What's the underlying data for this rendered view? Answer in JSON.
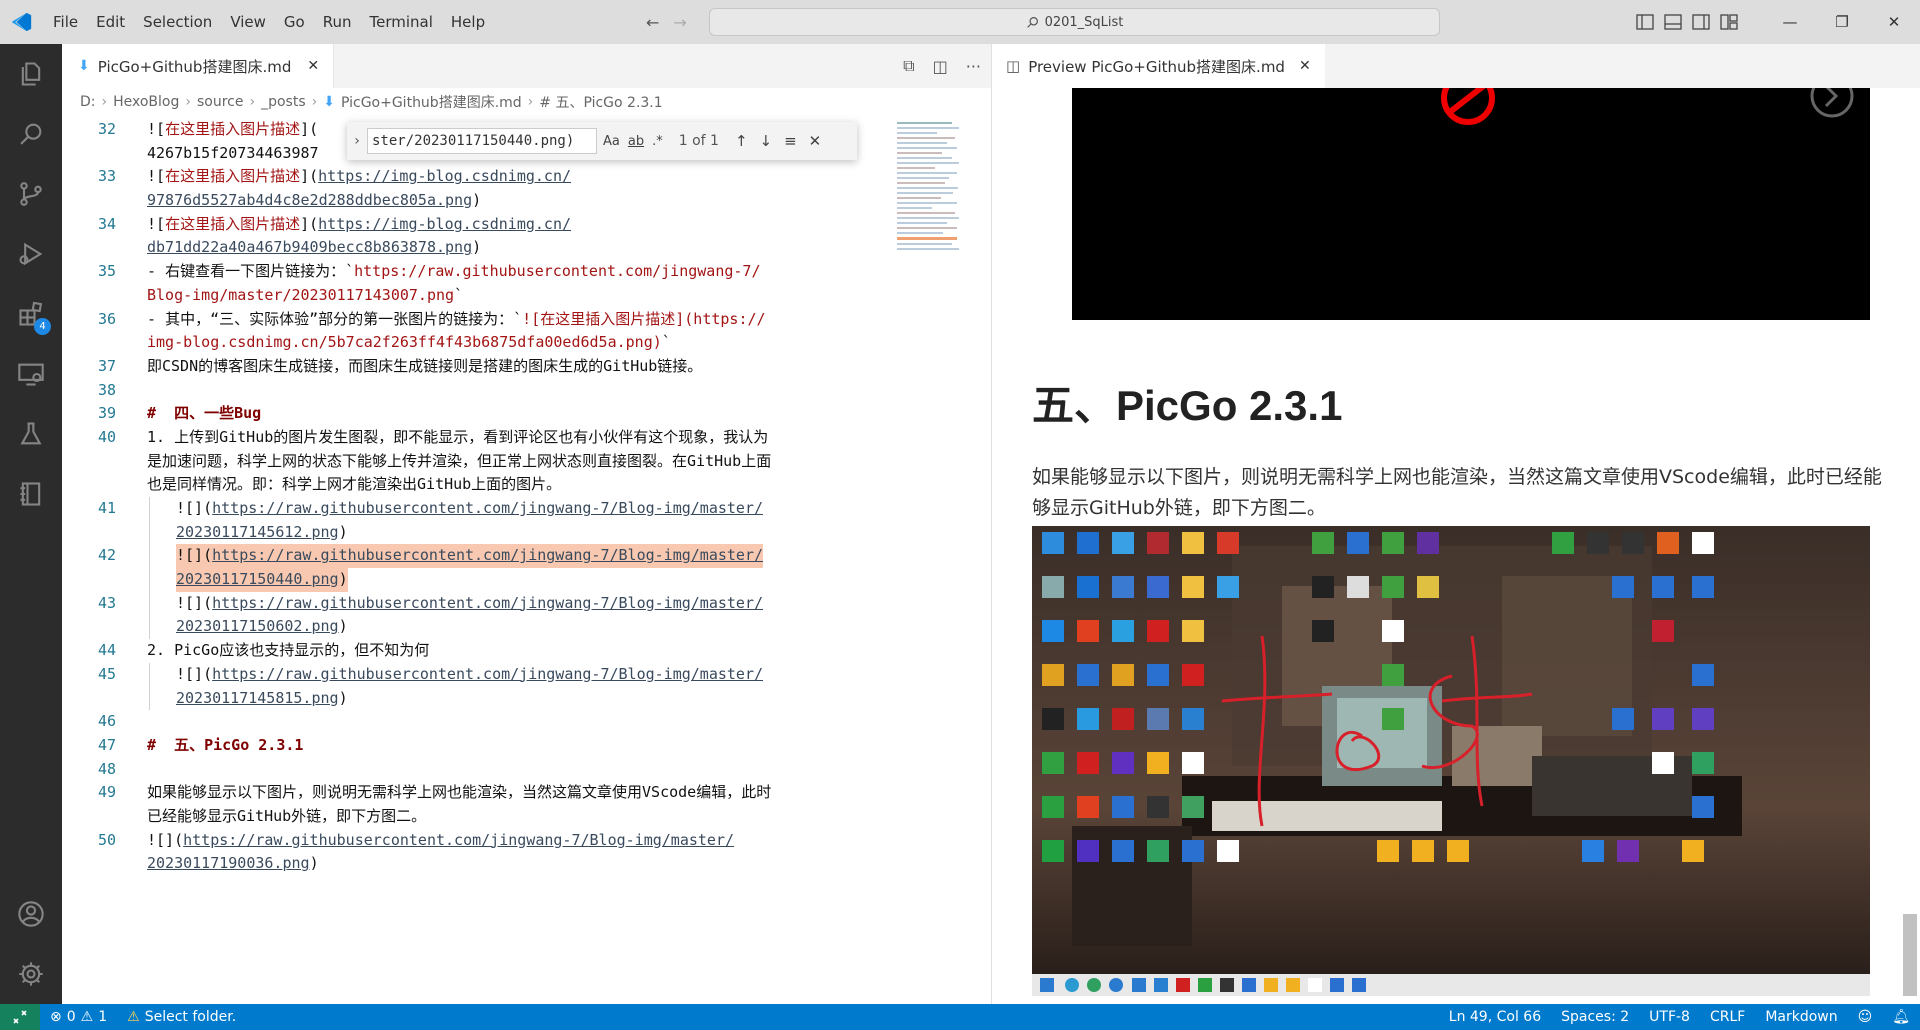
{
  "titlebar": {
    "menu": [
      "File",
      "Edit",
      "Selection",
      "View",
      "Go",
      "Run",
      "Terminal",
      "Help"
    ],
    "search": "0201_SqList"
  },
  "editor": {
    "tab_title": "PicGo+Github搭建图床.md",
    "breadcrumb": [
      "D:",
      "HexoBlog",
      "source",
      "_posts",
      "PicGo+Github搭建图床.md",
      "# 五、PicGo 2.3.1"
    ],
    "find": {
      "query": "ster/20230117150440.png)",
      "case": "Aa",
      "word": "ab",
      "regex": ".*",
      "count": "1 of 1"
    },
    "lines": [
      {
        "n": "32",
        "segs": [
          [
            "![",
            ""
          ],
          [
            "在这里插入图片描述",
            "red"
          ],
          [
            "](",
            ""
          ],
          [
            "",
            ""
          ]
        ]
      },
      {
        "n": "",
        "segs": [
          [
            "4267b15f20734463987",
            ""
          ]
        ]
      },
      {
        "n": "33",
        "segs": [
          [
            "![",
            ""
          ],
          [
            "在这里插入图片描述",
            "red"
          ],
          [
            "](",
            ""
          ],
          [
            "https://img-blog.csdnimg.cn/",
            "link"
          ]
        ]
      },
      {
        "n": "",
        "segs": [
          [
            "97876d5527ab4d4c8e2d288ddbec805a.png",
            "link"
          ],
          [
            ")",
            ""
          ]
        ]
      },
      {
        "n": "34",
        "segs": [
          [
            "![",
            ""
          ],
          [
            "在这里插入图片描述",
            "red"
          ],
          [
            "](",
            ""
          ],
          [
            "https://img-blog.csdnimg.cn/",
            "link"
          ]
        ]
      },
      {
        "n": "",
        "segs": [
          [
            "db71dd22a40a467b9409becc8b863878.png",
            "link"
          ],
          [
            ")",
            ""
          ]
        ]
      },
      {
        "n": "35",
        "segs": [
          [
            "- ",
            ""
          ],
          [
            "右键查看一下图片链接为：`",
            ""
          ],
          [
            "https://raw.githubusercontent.com/jingwang-7/",
            "red"
          ]
        ]
      },
      {
        "n": "",
        "segs": [
          [
            "Blog-img/master/20230117143007.png",
            "red"
          ],
          [
            "`",
            ""
          ]
        ]
      },
      {
        "n": "36",
        "segs": [
          [
            "- ",
            ""
          ],
          [
            "其中，“三、实际体验”部分的第一张图片的链接为：`",
            ""
          ],
          [
            "![在这里插入图片描述](https://",
            "red"
          ]
        ]
      },
      {
        "n": "",
        "segs": [
          [
            "img-blog.csdnimg.cn/5b7ca2f263ff4f43b6875dfa00ed6d5a.png)",
            "red"
          ],
          [
            "`",
            ""
          ]
        ]
      },
      {
        "n": "37",
        "segs": [
          [
            "即CSDN的博客图床生成链接，而图床生成链接则是搭建的图床生成的GitHub链接。",
            ""
          ]
        ]
      },
      {
        "n": "38",
        "segs": [
          [
            "",
            ""
          ]
        ]
      },
      {
        "n": "39",
        "segs": [
          [
            "#  四、一些Bug",
            "hdr"
          ]
        ]
      },
      {
        "n": "40",
        "segs": [
          [
            "1. 上传到GitHub的图片发生图裂，即不能显示，看到评论区也有小伙伴有这个现象，我认为",
            ""
          ]
        ]
      },
      {
        "n": "",
        "segs": [
          [
            "是加速问题，科学上网的状态下能够上传并渲染，但正常上网状态则直接图裂。在GitHub上面",
            ""
          ]
        ]
      },
      {
        "n": "",
        "segs": [
          [
            "也是同样情况。即：科学上网才能渲染出GitHub上面的图片。",
            ""
          ]
        ]
      },
      {
        "n": "41",
        "ind": true,
        "segs": [
          [
            "![](",
            ""
          ],
          [
            "https://raw.githubusercontent.com/jingwang-7/Blog-img/master/",
            "link"
          ]
        ]
      },
      {
        "n": "",
        "ind": true,
        "segs": [
          [
            "20230117145612.png",
            "link"
          ],
          [
            ")",
            ""
          ]
        ]
      },
      {
        "n": "42",
        "ind": true,
        "hl": true,
        "segs": [
          [
            "![](",
            ""
          ],
          [
            "https://raw.githubusercontent.com/jingwang-7/Blog-img/master/",
            "link"
          ]
        ]
      },
      {
        "n": "",
        "ind": true,
        "hl": true,
        "segs": [
          [
            "20230117150440.png",
            "link"
          ],
          [
            ")",
            ""
          ]
        ]
      },
      {
        "n": "43",
        "ind": true,
        "segs": [
          [
            "![](",
            ""
          ],
          [
            "https://raw.githubusercontent.com/jingwang-7/Blog-img/master/",
            "link"
          ]
        ]
      },
      {
        "n": "",
        "ind": true,
        "segs": [
          [
            "20230117150602.png",
            "link"
          ],
          [
            ")",
            ""
          ]
        ]
      },
      {
        "n": "44",
        "segs": [
          [
            "2. PicGo应该也支持显示的，但不知为何",
            ""
          ]
        ]
      },
      {
        "n": "45",
        "ind": true,
        "segs": [
          [
            "![](",
            ""
          ],
          [
            "https://raw.githubusercontent.com/jingwang-7/Blog-img/master/",
            "link"
          ]
        ]
      },
      {
        "n": "",
        "ind": true,
        "segs": [
          [
            "20230117145815.png",
            "link"
          ],
          [
            ")",
            ""
          ]
        ]
      },
      {
        "n": "46",
        "segs": [
          [
            "",
            ""
          ]
        ]
      },
      {
        "n": "47",
        "segs": [
          [
            "#  五、PicGo 2.3.1",
            "hdr"
          ]
        ]
      },
      {
        "n": "48",
        "segs": [
          [
            "",
            ""
          ]
        ]
      },
      {
        "n": "49",
        "segs": [
          [
            "如果能够显示以下图片，则说明无需科学上网也能渲染，当然这篇文章使用VScode编辑，此时",
            ""
          ]
        ]
      },
      {
        "n": "",
        "segs": [
          [
            "已经能够显示GitHub外链，即下方图二。",
            ""
          ]
        ]
      },
      {
        "n": "50",
        "segs": [
          [
            "![](",
            ""
          ],
          [
            "https://raw.githubusercontent.com/jingwang-7/Blog-img/master/",
            "link"
          ]
        ]
      },
      {
        "n": "",
        "segs": [
          [
            "20230117190036.png",
            "link"
          ],
          [
            ")",
            ""
          ]
        ]
      }
    ]
  },
  "preview": {
    "tab_title": "Preview PicGo+Github搭建图床.md",
    "heading": "五、PicGo 2.3.1",
    "paragraph": "如果能够显示以下图片，则说明无需科学上网也能渲染，当然这篇文章使用VScode编辑，此时已经能够显示GitHub外链，即下方图二。"
  },
  "statusbar": {
    "errors": "0",
    "warnings": "1",
    "select_folder": "Select folder.",
    "position": "Ln 49, Col 66",
    "spaces": "Spaces: 2",
    "encoding": "UTF-8",
    "eol": "CRLF",
    "language": "Markdown"
  },
  "colors": {
    "accent": "#007acc",
    "activity_bar": "#2c2c2c",
    "line_highlight": "#f8c9b0",
    "badge": "#1e88e5"
  },
  "icons": [
    "vscode-logo",
    "explorer-icon",
    "search-icon",
    "source-control-icon",
    "run-debug-icon",
    "extensions-icon",
    "remote-explorer-icon",
    "testing-icon",
    "notebook-icon",
    "account-icon",
    "settings-gear-icon"
  ]
}
